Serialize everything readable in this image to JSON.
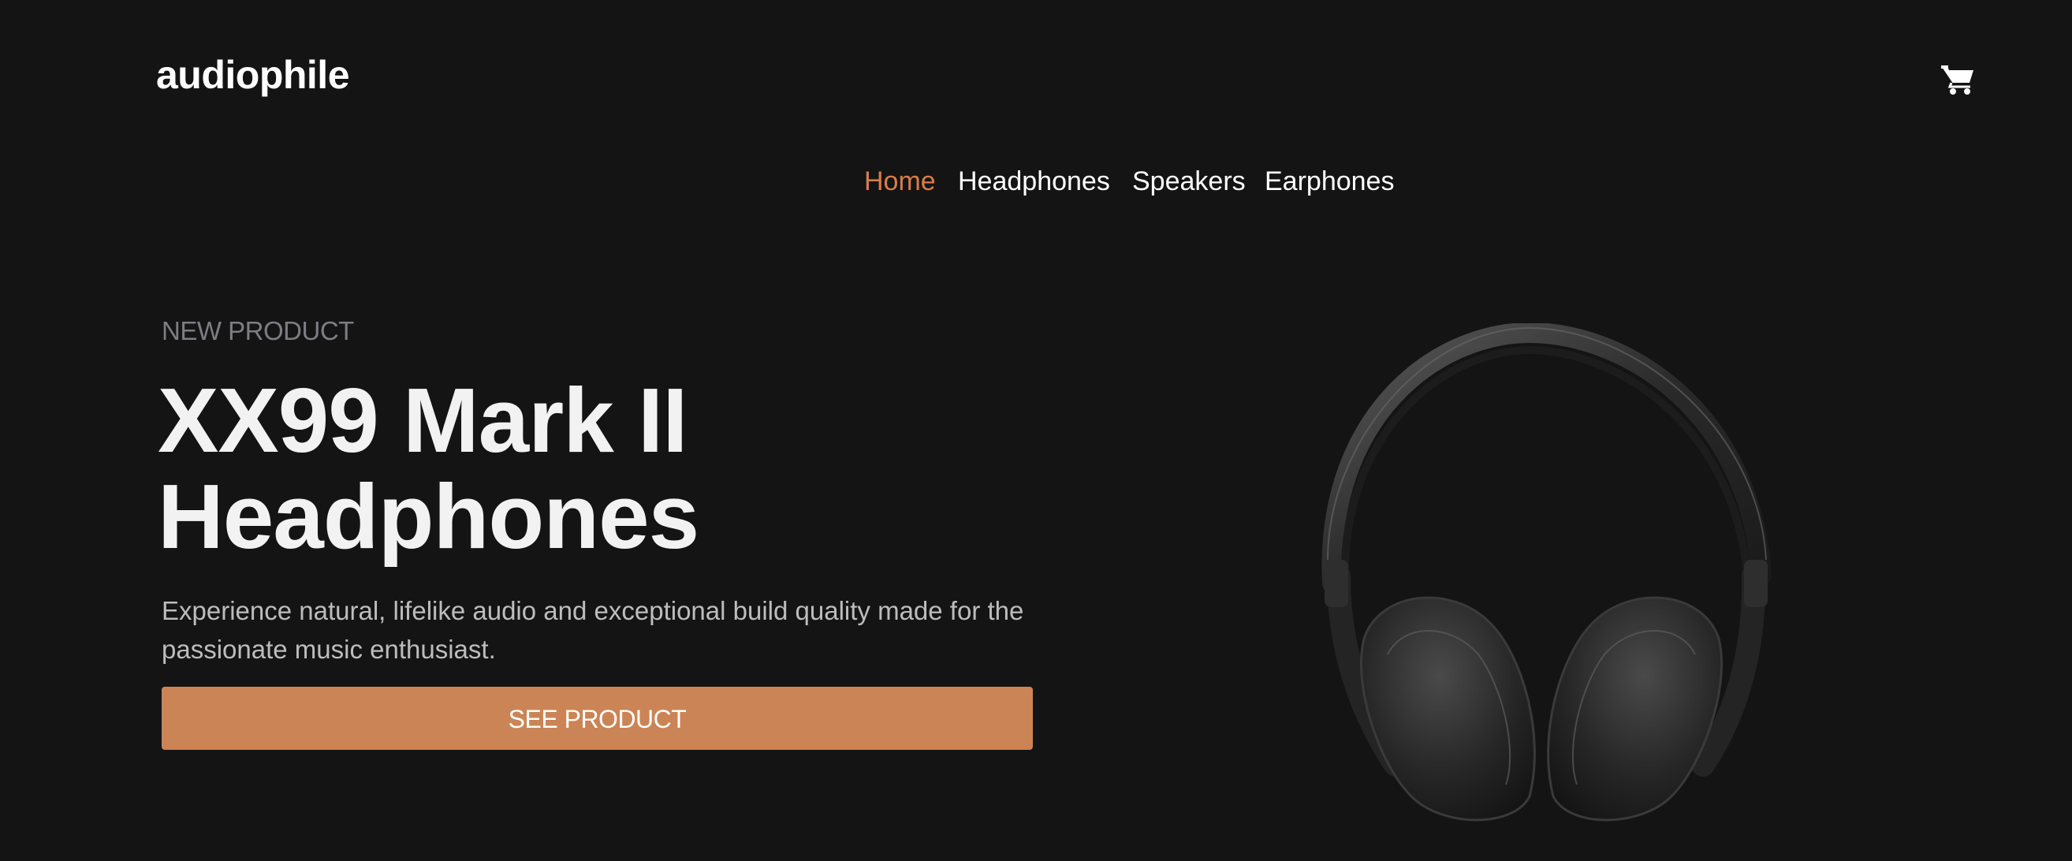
{
  "header": {
    "logo": "audiophile",
    "cart_icon": "shopping-cart-icon"
  },
  "nav": {
    "items": [
      {
        "label": "Home",
        "active": true
      },
      {
        "label": "Headphones",
        "active": false
      },
      {
        "label": "Speakers",
        "active": false
      },
      {
        "label": "Earphones",
        "active": false
      }
    ]
  },
  "hero": {
    "eyebrow": "NEW PRODUCT",
    "title_line1": "XX99 Mark II",
    "title_line2": "Headphones",
    "description": "Experience natural, lifelike audio and exceptional build quality made for the passionate music enthusiast.",
    "cta_label": "SEE PRODUCT",
    "image": "headphones-product-image"
  },
  "colors": {
    "background": "#141414",
    "accent": "#D87D4A",
    "button": "#CB8456",
    "text": "#FFFFFF",
    "muted": "#7D7D82"
  }
}
